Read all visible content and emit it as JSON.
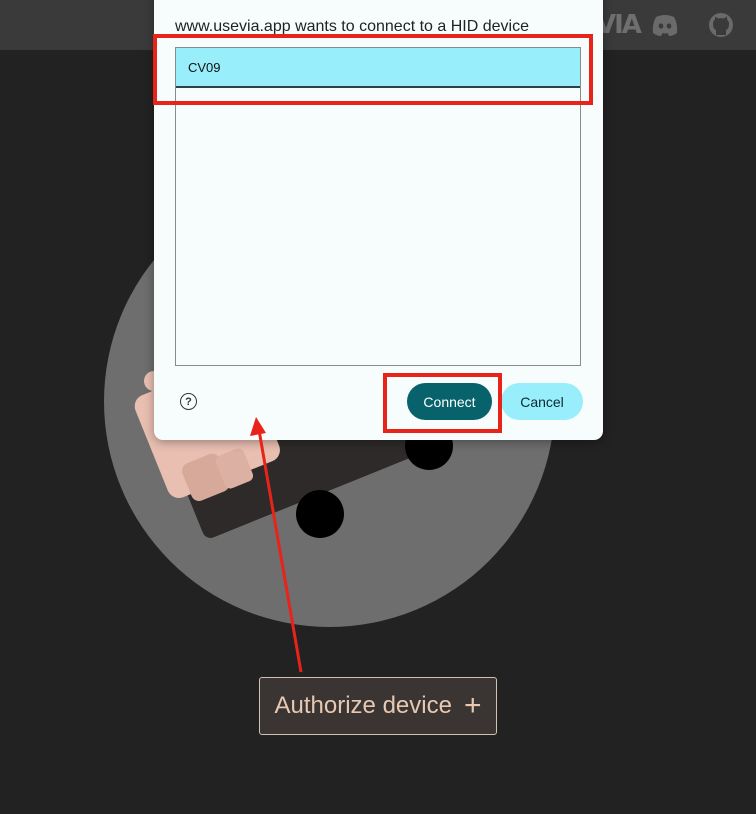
{
  "header": {
    "logo_text": "VIA",
    "icons": [
      "discord-icon",
      "github-icon"
    ]
  },
  "dialog": {
    "title": "www.usevia.app wants to connect to a HID device",
    "devices": [
      {
        "label": "CV09",
        "selected": true
      }
    ],
    "help_icon": "?",
    "connect_label": "Connect",
    "cancel_label": "Cancel"
  },
  "main": {
    "authorize_label": "Authorize device",
    "authorize_icon": "+"
  },
  "colors": {
    "background": "#222222",
    "topbar": "#3a3a3a",
    "selected_row": "#98eefb",
    "connect": "#07626b",
    "cancel": "#98eefb",
    "annotation": "#e8231a",
    "authorize_text": "#e8c8b0"
  }
}
